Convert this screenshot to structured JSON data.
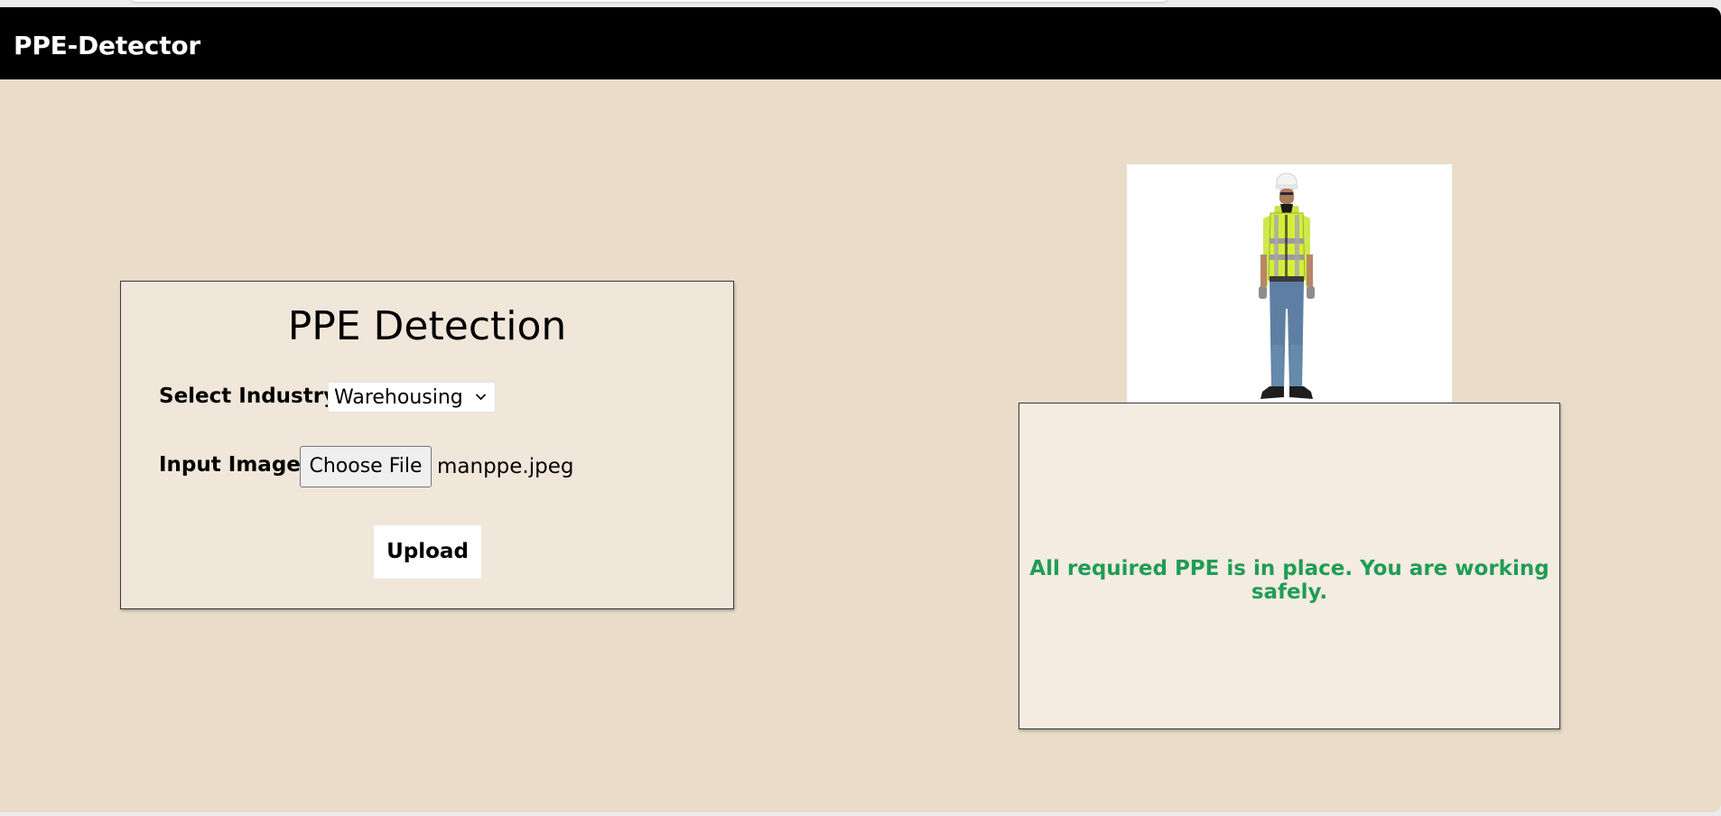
{
  "navbar": {
    "brand": "PPE-Detector"
  },
  "form": {
    "title": "PPE Detection",
    "industry_label": "Select Industry:",
    "industry_selected": "Warehousing",
    "image_label": "Input Image:",
    "choose_file_label": "Choose File",
    "file_name": "manppe.jpeg",
    "upload_label": "Upload"
  },
  "result": {
    "message": "All required PPE is in place. You are working safely.",
    "message_color": "#1f9d55"
  },
  "colors": {
    "navbar_bg": "#000000",
    "page_bg": "#e9dcc9",
    "card_bg": "#f0e6da"
  },
  "icons": {
    "select_chevron": "chevron-down-icon"
  }
}
